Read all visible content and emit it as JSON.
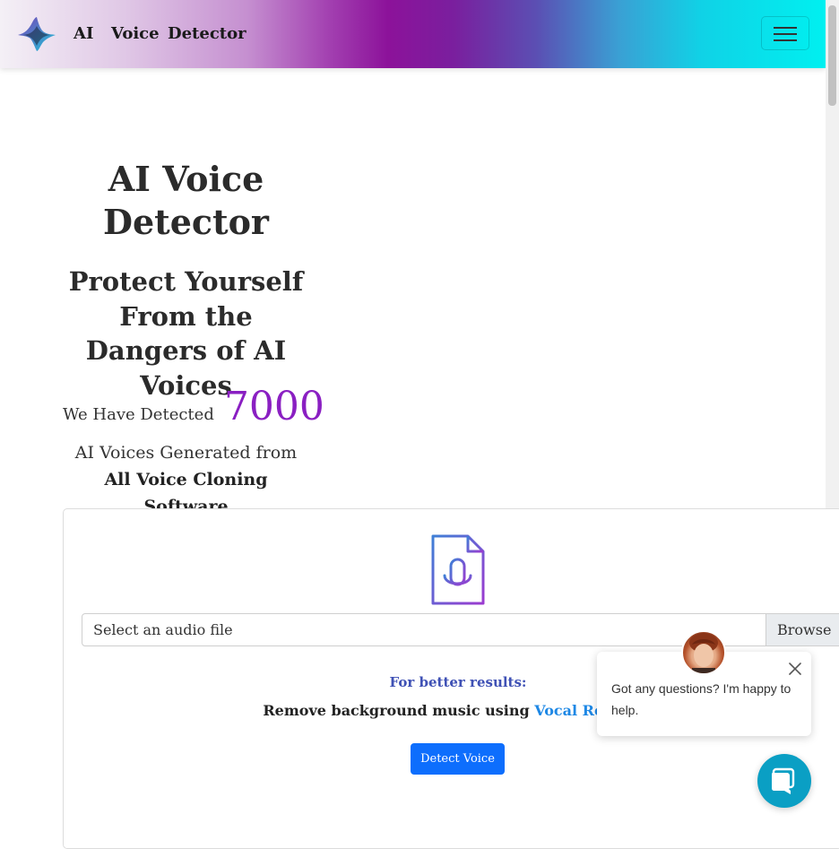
{
  "navbar": {
    "brand_words": [
      "AI",
      "Voice",
      "Detector"
    ],
    "logo_icon": "waveform-logo-icon",
    "menu_icon": "hamburger-menu-icon"
  },
  "hero": {
    "title": "AI Voice Detector",
    "subtitle": "Protect Yourself From the Dangers of AI Voices",
    "detected_lead": "We Have Detected",
    "detected_count": "7000",
    "generated_text": "AI Voices Generated from ",
    "generated_bold": "All Voice Cloning Software"
  },
  "upload": {
    "icon": "audio-file-icon",
    "file_label": "Select an audio file",
    "browse_label": "Browse",
    "tip_title": "For better results:",
    "tip_text": "Remove background music using ",
    "tip_link": "Vocal Remover",
    "detect_button": "Detect Voice"
  },
  "chat": {
    "message": "Got any questions? I'm happy to help.",
    "close_icon": "close-icon",
    "launcher_icon": "chat-bubble-icon"
  },
  "colors": {
    "counter": "#8a1fc2",
    "button": "#0d6efd",
    "link": "#1e88e5",
    "tip_title": "#3f51b5",
    "chat_launcher": "#0a9fc4"
  }
}
